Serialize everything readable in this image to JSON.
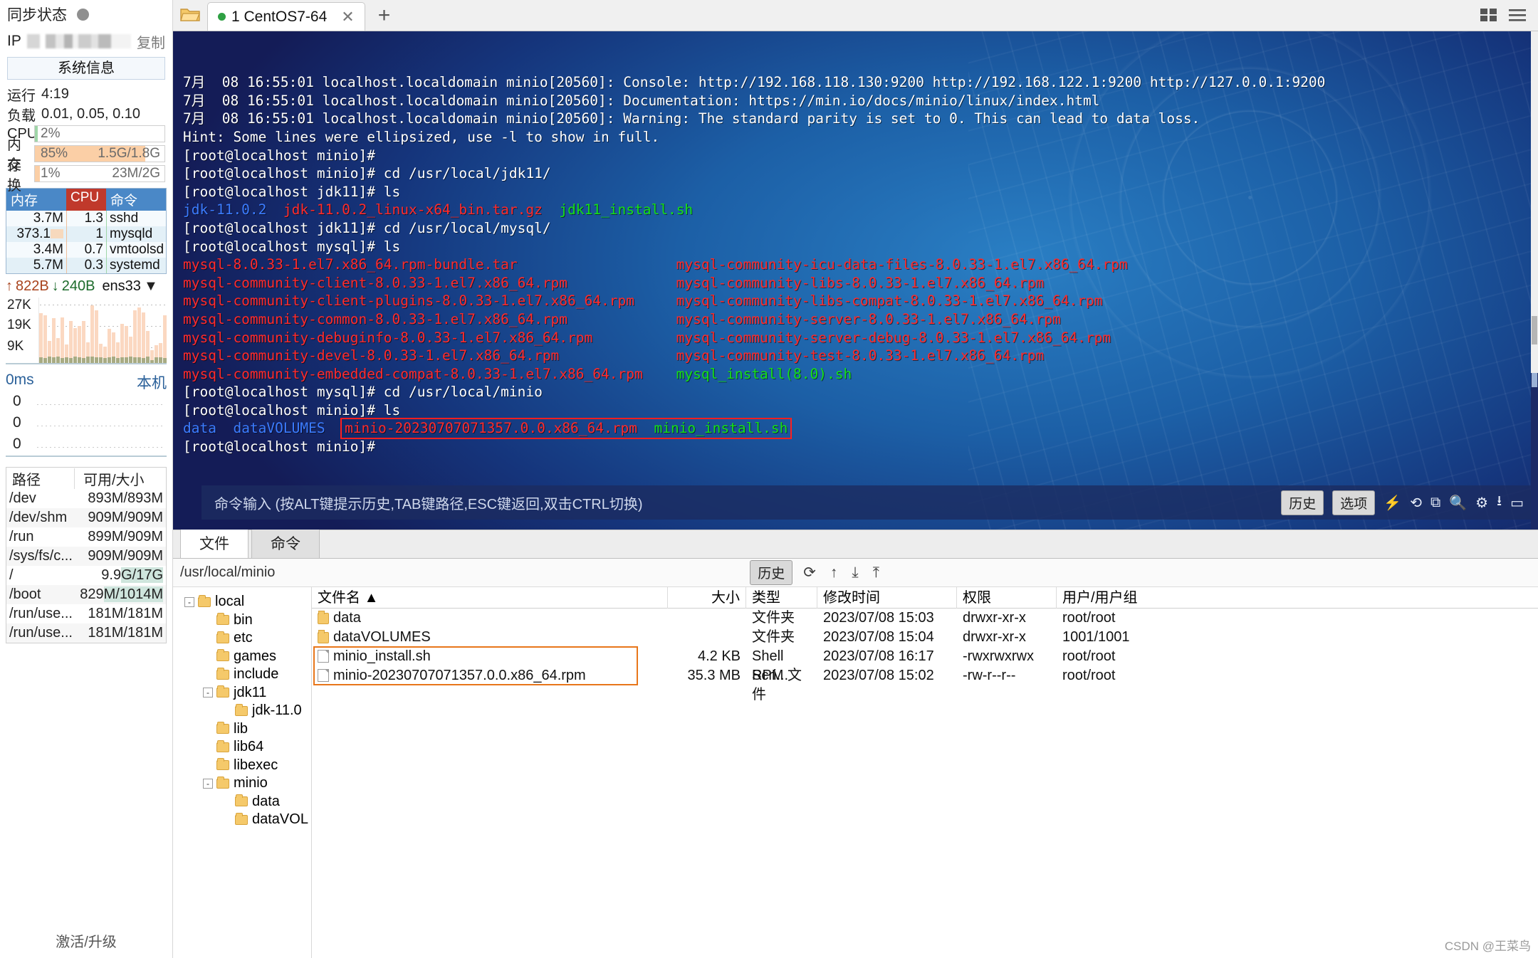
{
  "sidebar": {
    "sync_label": "同步状态",
    "ip_label": "IP",
    "copy_label": "复制",
    "sysinfo_button": "系统信息",
    "uptime_label": "运行",
    "uptime_value": "4:19",
    "load_label": "负载",
    "load_value": "0.01, 0.05, 0.10",
    "meters": [
      {
        "label": "CPU",
        "percent": "2%",
        "amount": "",
        "pct_num": 2,
        "color": "#9fd6a8"
      },
      {
        "label": "内存",
        "percent": "85%",
        "amount": "1.5G/1.8G",
        "pct_num": 85,
        "color": "#fbcfa6"
      },
      {
        "label": "交换",
        "percent": "1%",
        "amount": "23M/2G",
        "pct_num": 4,
        "color": "#fbcfa6"
      }
    ],
    "proc_headers": [
      "内存",
      "CPU",
      "命令"
    ],
    "proc_rows": [
      {
        "mem": "3.7M",
        "cpu": "1.3",
        "cmd": "sshd"
      },
      {
        "mem": "373.1",
        "cpu": "1",
        "cmd": "mysqld"
      },
      {
        "mem": "3.4M",
        "cpu": "0.7",
        "cmd": "vmtoolsd"
      },
      {
        "mem": "5.7M",
        "cpu": "0.3",
        "cmd": "systemd"
      }
    ],
    "net": {
      "up_value": "822B",
      "down_value": "240B",
      "interface": "ens33",
      "y_ticks": [
        "27K",
        "19K",
        "9K"
      ]
    },
    "ping": {
      "latency": "0ms",
      "host_label": "本机",
      "rows": [
        "0",
        "0",
        "0"
      ]
    },
    "disk_headers": [
      "路径",
      "可用/大小"
    ],
    "disk_rows": [
      {
        "path": "/dev",
        "size": "893M/893M",
        "hl": false
      },
      {
        "path": "/dev/shm",
        "size": "909M/909M",
        "hl": false
      },
      {
        "path": "/run",
        "size": "899M/909M",
        "hl": false
      },
      {
        "path": "/sys/fs/c...",
        "size": "909M/909M",
        "hl": false
      },
      {
        "path": "/",
        "size": "9.9G/17G",
        "hl": true
      },
      {
        "path": "/boot",
        "size": "829M/1014M",
        "hl": true
      },
      {
        "path": "/run/use...",
        "size": "181M/181M",
        "hl": false
      },
      {
        "path": "/run/use...",
        "size": "181M/181M",
        "hl": false
      }
    ],
    "activate_label": "激活/升级"
  },
  "tabbar": {
    "tab_label": "1 CentOS7-64",
    "close_glyph": "✕",
    "plus_glyph": "+"
  },
  "terminal": {
    "lines": [
      {
        "parts": [
          {
            "t": "7月  08 16:55:01 localhost.localdomain minio[20560]: Console: http://192.168.118.130:9200 http://192.168.122.1:9200 http://127.0.0.1:9200",
            "c": "c-white"
          }
        ]
      },
      {
        "parts": [
          {
            "t": "7月  08 16:55:01 localhost.localdomain minio[20560]: Documentation: https://min.io/docs/minio/linux/index.html",
            "c": "c-white"
          }
        ]
      },
      {
        "parts": [
          {
            "t": "7月  08 16:55:01 localhost.localdomain minio[20560]: Warning: The standard parity is set to 0. This can lead to data loss.",
            "c": "c-white"
          }
        ]
      },
      {
        "parts": [
          {
            "t": "Hint: Some lines were ellipsized, use -l to show in full.",
            "c": "c-white"
          }
        ]
      },
      {
        "parts": [
          {
            "t": "[root@localhost minio]#",
            "c": "c-white"
          }
        ]
      },
      {
        "parts": [
          {
            "t": "[root@localhost minio]# cd /usr/local/jdk11/",
            "c": "c-white"
          }
        ]
      },
      {
        "parts": [
          {
            "t": "[root@localhost jdk11]# ls",
            "c": "c-white"
          }
        ]
      },
      {
        "parts": [
          {
            "t": "jdk-11.0.2",
            "c": "c-blue"
          },
          {
            "t": "  ",
            "c": "c-white"
          },
          {
            "t": "jdk-11.0.2_linux-x64_bin.tar.gz",
            "c": "c-red"
          },
          {
            "t": "  ",
            "c": "c-white"
          },
          {
            "t": "jdk11_install.sh",
            "c": "c-green"
          }
        ]
      },
      {
        "parts": [
          {
            "t": "[root@localhost jdk11]# cd /usr/local/mysql/",
            "c": "c-white"
          }
        ]
      },
      {
        "parts": [
          {
            "t": "[root@localhost mysql]# ls",
            "c": "c-white"
          }
        ]
      },
      {
        "parts": [
          {
            "t": "mysql-8.0.33-1.el7.x86_64.rpm-bundle.tar",
            "c": "c-red",
            "col": true
          },
          {
            "t": "mysql-community-icu-data-files-8.0.33-1.el7.x86_64.rpm",
            "c": "c-red"
          }
        ]
      },
      {
        "parts": [
          {
            "t": "mysql-community-client-8.0.33-1.el7.x86_64.rpm",
            "c": "c-red",
            "col": true
          },
          {
            "t": "mysql-community-libs-8.0.33-1.el7.x86_64.rpm",
            "c": "c-red"
          }
        ]
      },
      {
        "parts": [
          {
            "t": "mysql-community-client-plugins-8.0.33-1.el7.x86_64.rpm",
            "c": "c-red",
            "col": true
          },
          {
            "t": "mysql-community-libs-compat-8.0.33-1.el7.x86_64.rpm",
            "c": "c-red"
          }
        ]
      },
      {
        "parts": [
          {
            "t": "mysql-community-common-8.0.33-1.el7.x86_64.rpm",
            "c": "c-red",
            "col": true
          },
          {
            "t": "mysql-community-server-8.0.33-1.el7.x86_64.rpm",
            "c": "c-red"
          }
        ]
      },
      {
        "parts": [
          {
            "t": "mysql-community-debuginfo-8.0.33-1.el7.x86_64.rpm",
            "c": "c-red",
            "col": true
          },
          {
            "t": "mysql-community-server-debug-8.0.33-1.el7.x86_64.rpm",
            "c": "c-red"
          }
        ]
      },
      {
        "parts": [
          {
            "t": "mysql-community-devel-8.0.33-1.el7.x86_64.rpm",
            "c": "c-red",
            "col": true
          },
          {
            "t": "mysql-community-test-8.0.33-1.el7.x86_64.rpm",
            "c": "c-red"
          }
        ]
      },
      {
        "parts": [
          {
            "t": "mysql-community-embedded-compat-8.0.33-1.el7.x86_64.rpm",
            "c": "c-red",
            "col": true
          },
          {
            "t": "mysql_install(8.0).sh",
            "c": "c-green"
          }
        ]
      },
      {
        "parts": [
          {
            "t": "[root@localhost mysql]# cd /usr/local/minio",
            "c": "c-white"
          }
        ]
      },
      {
        "parts": [
          {
            "t": "[root@localhost minio]# ls",
            "c": "c-white"
          }
        ]
      },
      {
        "parts": [
          {
            "t": "data",
            "c": "c-blue"
          },
          {
            "t": "  ",
            "c": "c-white"
          },
          {
            "t": "dataVOLUMES",
            "c": "c-blue"
          },
          {
            "t": "  ",
            "c": "c-white"
          },
          {
            "t": "minio-20230707071357.0.0.x86_64.rpm",
            "c": "c-red",
            "box": "start"
          },
          {
            "t": "  ",
            "c": "c-white"
          },
          {
            "t": "minio_install.sh",
            "c": "c-green"
          }
        ]
      },
      {
        "parts": [
          {
            "t": "[root@localhost minio]#",
            "c": "c-white"
          }
        ]
      }
    ],
    "command_placeholder": "命令输入 (按ALT键提示历史,TAB键路径,ESC键返回,双击CTRL切换)",
    "history_button": "历史",
    "options_button": "选项"
  },
  "filepanel": {
    "tabs": [
      {
        "label": "文件",
        "active": true
      },
      {
        "label": "命令",
        "active": false
      }
    ],
    "path": "/usr/local/minio",
    "history_button": "历史",
    "tree": [
      {
        "label": "local",
        "depth": 0,
        "toggle": "-"
      },
      {
        "label": "bin",
        "depth": 1,
        "toggle": ""
      },
      {
        "label": "etc",
        "depth": 1,
        "toggle": ""
      },
      {
        "label": "games",
        "depth": 1,
        "toggle": ""
      },
      {
        "label": "include",
        "depth": 1,
        "toggle": ""
      },
      {
        "label": "jdk11",
        "depth": 1,
        "toggle": "-"
      },
      {
        "label": "jdk-11.0",
        "depth": 2,
        "toggle": ""
      },
      {
        "label": "lib",
        "depth": 1,
        "toggle": ""
      },
      {
        "label": "lib64",
        "depth": 1,
        "toggle": ""
      },
      {
        "label": "libexec",
        "depth": 1,
        "toggle": ""
      },
      {
        "label": "minio",
        "depth": 1,
        "toggle": "-"
      },
      {
        "label": "data",
        "depth": 2,
        "toggle": ""
      },
      {
        "label": "dataVOL",
        "depth": 2,
        "toggle": ""
      }
    ],
    "columns": [
      "文件名",
      "大小",
      "类型",
      "修改时间",
      "权限",
      "用户/用户组"
    ],
    "sort_glyph": "▲",
    "rows": [
      {
        "name": "data",
        "icon": "fold",
        "size": "",
        "type": "文件夹",
        "mtime": "2023/07/08 15:03",
        "perm": "drwxr-xr-x",
        "owner": "root/root"
      },
      {
        "name": "dataVOLUMES",
        "icon": "fold",
        "size": "",
        "type": "文件夹",
        "mtime": "2023/07/08 15:04",
        "perm": "drwxr-xr-x",
        "owner": "1001/1001"
      },
      {
        "name": "minio_install.sh",
        "icon": "doc",
        "size": "4.2 KB",
        "type": "Shell Scri...",
        "mtime": "2023/07/08 16:17",
        "perm": "-rwxrwxrwx",
        "owner": "root/root"
      },
      {
        "name": "minio-20230707071357.0.0.x86_64.rpm",
        "icon": "doc",
        "size": "35.3 MB",
        "type": "RPM 文件",
        "mtime": "2023/07/08 15:02",
        "perm": "-rw-r--r--",
        "owner": "root/root"
      }
    ]
  },
  "watermark": "CSDN @王菜鸟",
  "colors": {
    "accent_blue": "#4a88c7",
    "cpu_red": "#c0392b",
    "term_red": "#ff2b2b",
    "term_green": "#16e016",
    "term_blue": "#3b7cff",
    "select_orange": "#e8761a",
    "highlight_red": "#ff1f1f"
  }
}
